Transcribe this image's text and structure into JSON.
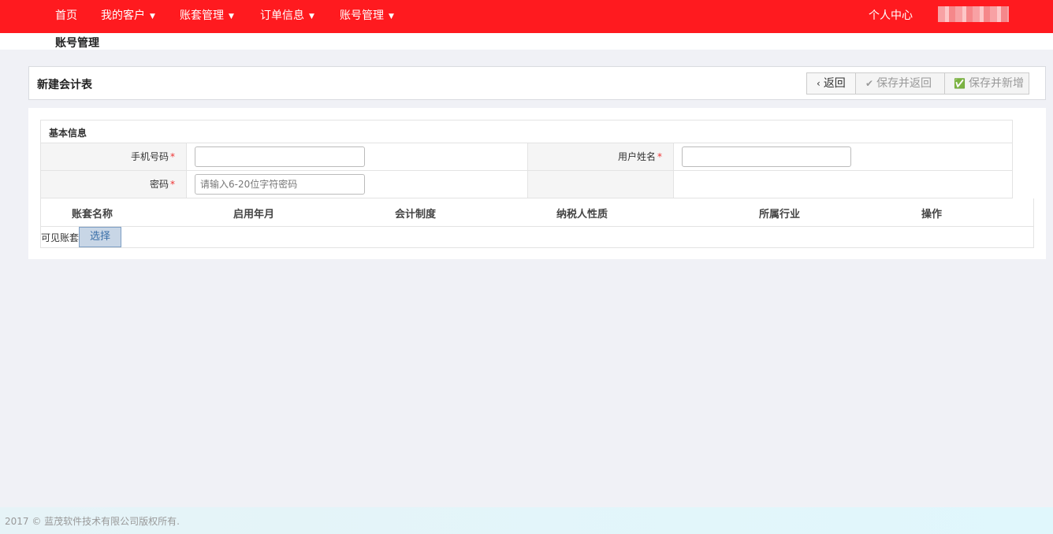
{
  "nav": {
    "home": "首页",
    "customers": "我的客户",
    "accounts_set": "账套管理",
    "orders": "订单信息",
    "account_mgmt": "账号管理",
    "profile": "个人中心",
    "caret": "▼"
  },
  "breadcrumb": "账号管理",
  "panel": {
    "title": "新建会计表",
    "back_label": "返回",
    "save_back_label": "保存并返回",
    "save_new_label": "保存并新增"
  },
  "form": {
    "section_title": "基本信息",
    "phone_label": "手机号码",
    "username_label": "用户姓名",
    "password_label": "密码",
    "required_mark": "*",
    "phone_value": "",
    "username_value": "",
    "password_placeholder": "请输入6-20位字符密码"
  },
  "table": {
    "headers": [
      "账套名称",
      "启用年月",
      "会计制度",
      "纳税人性质",
      "所属行业",
      "操作"
    ]
  },
  "visible": {
    "label": "可见账套",
    "select_label": "选择"
  },
  "footer": "2017 © 蓝茂软件技术有限公司版权所有.",
  "colors": {
    "topbar": "#ff1a1f",
    "required": "#ee3333"
  }
}
